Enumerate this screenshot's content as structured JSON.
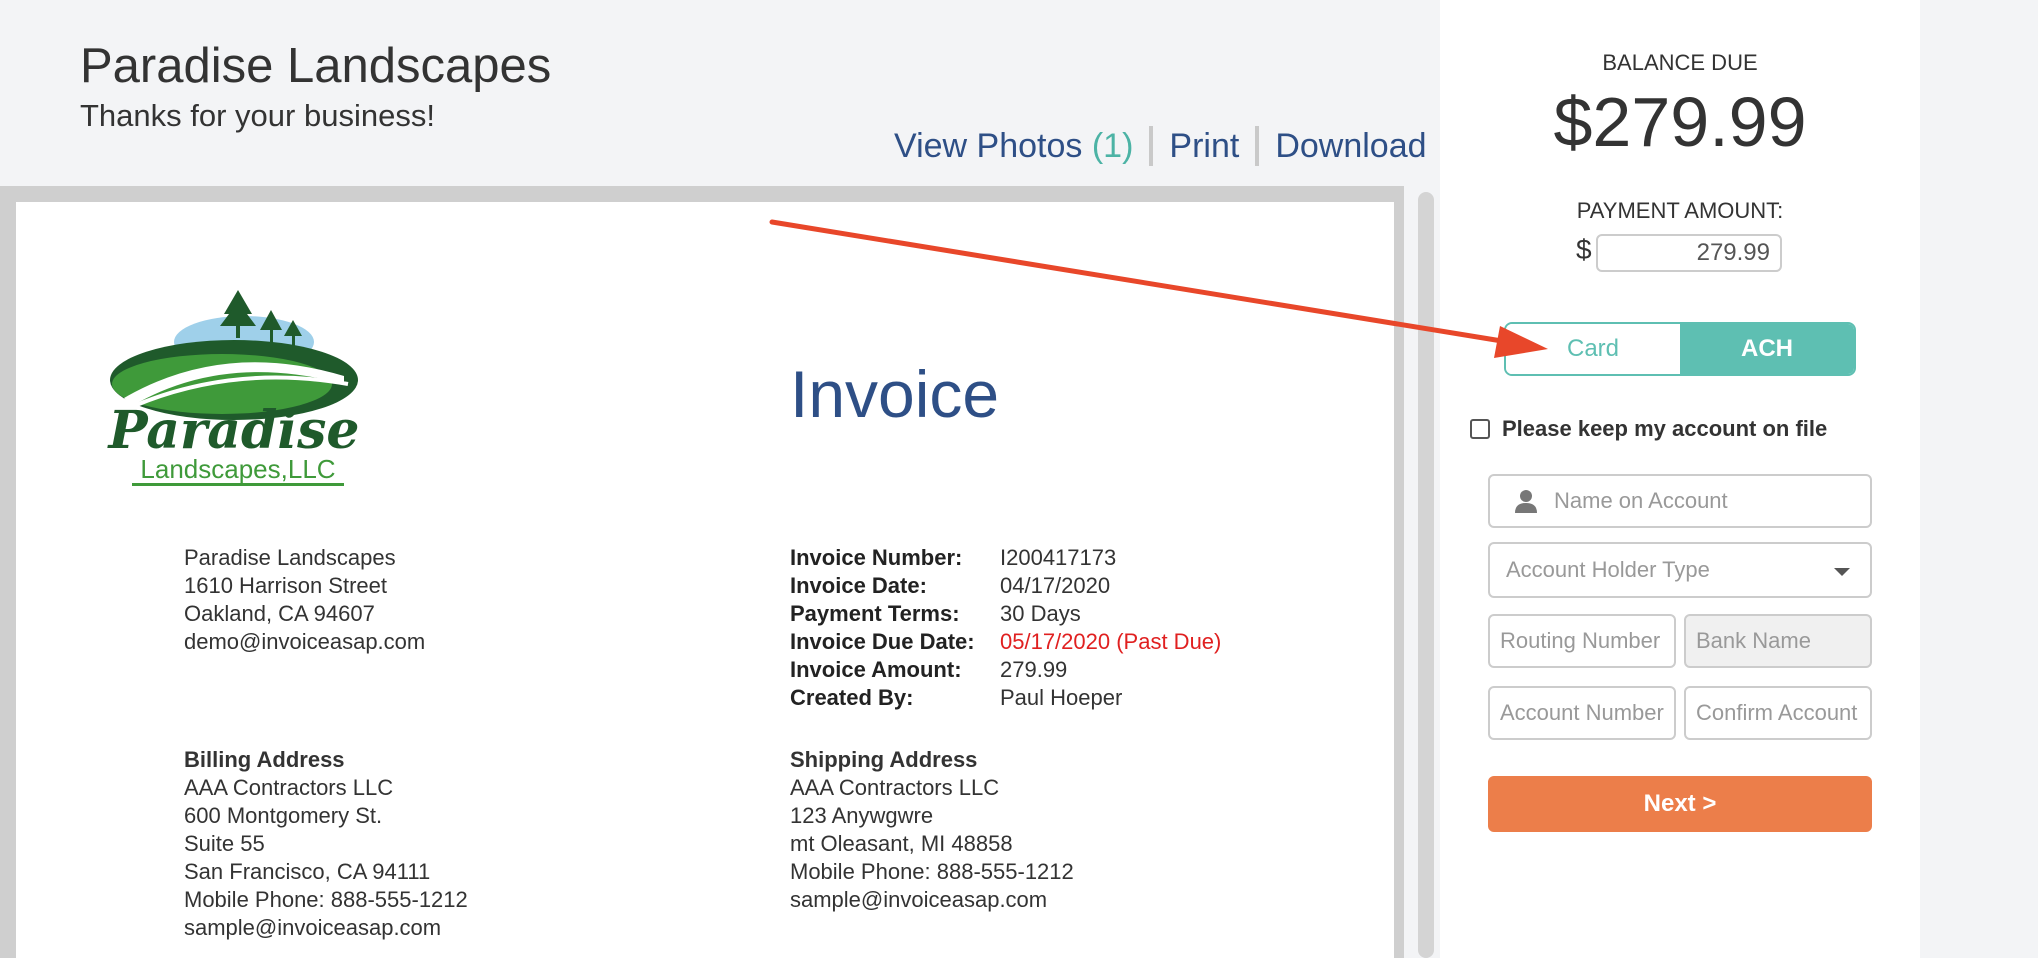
{
  "header": {
    "company": "Paradise Landscapes",
    "tagline": "Thanks for your business!",
    "links": {
      "view_photos": "View Photos",
      "photo_count": "(1)",
      "print": "Print",
      "download": "Download"
    }
  },
  "invoice": {
    "heading": "Invoice",
    "logo": {
      "icon": "paradise-landscapes-logo",
      "line1": "Paradise",
      "line2": "Landscapes,LLC"
    },
    "from": [
      "Paradise Landscapes",
      "1610 Harrison Street",
      "Oakland, CA 94607",
      "demo@invoiceasap.com"
    ],
    "details": [
      {
        "label": "Invoice Number:",
        "value": "I200417173"
      },
      {
        "label": "Invoice Date:",
        "value": "04/17/2020"
      },
      {
        "label": "Payment Terms:",
        "value": "30 Days"
      },
      {
        "label": "Invoice Due Date:",
        "value": "05/17/2020 (Past Due)"
      },
      {
        "label": "Invoice Amount:",
        "value": "279.99"
      },
      {
        "label": "Created By:",
        "value": "Paul Hoeper"
      }
    ],
    "billing": {
      "title": "Billing Address",
      "lines": [
        "AAA Contractors LLC",
        "600 Montgomery St.",
        "Suite 55",
        "San Francisco, CA 94111",
        "Mobile Phone: 888-555-1212",
        "sample@invoiceasap.com"
      ]
    },
    "shipping": {
      "title": "Shipping Address",
      "lines": [
        "AAA Contractors LLC",
        "123 Anywgwre",
        "mt Oleasant, MI 48858",
        "Mobile Phone: 888-555-1212",
        "sample@invoiceasap.com"
      ]
    }
  },
  "payment": {
    "balance_label": "BALANCE DUE",
    "balance_amount": "$279.99",
    "amount_label": "PAYMENT AMOUNT:",
    "currency_symbol": "$",
    "amount_value": "279.99",
    "tabs": {
      "card": "Card",
      "ach": "ACH",
      "active": "ACH"
    },
    "keep_on_file": "Please keep my account on file",
    "fields": {
      "name_on_account": "Name on Account",
      "holder_type": "Account Holder Type",
      "routing_number": "Routing Number",
      "bank_name": "Bank Name",
      "account_number": "Account Number",
      "confirm_account": "Confirm Account"
    },
    "next": "Next >"
  },
  "colors": {
    "accent_teal": "#5ebfb2",
    "link_blue": "#2e4f86",
    "next_orange": "#ec7e4a",
    "past_due_red": "#e02020",
    "annotation_arrow": "#e8472a"
  }
}
